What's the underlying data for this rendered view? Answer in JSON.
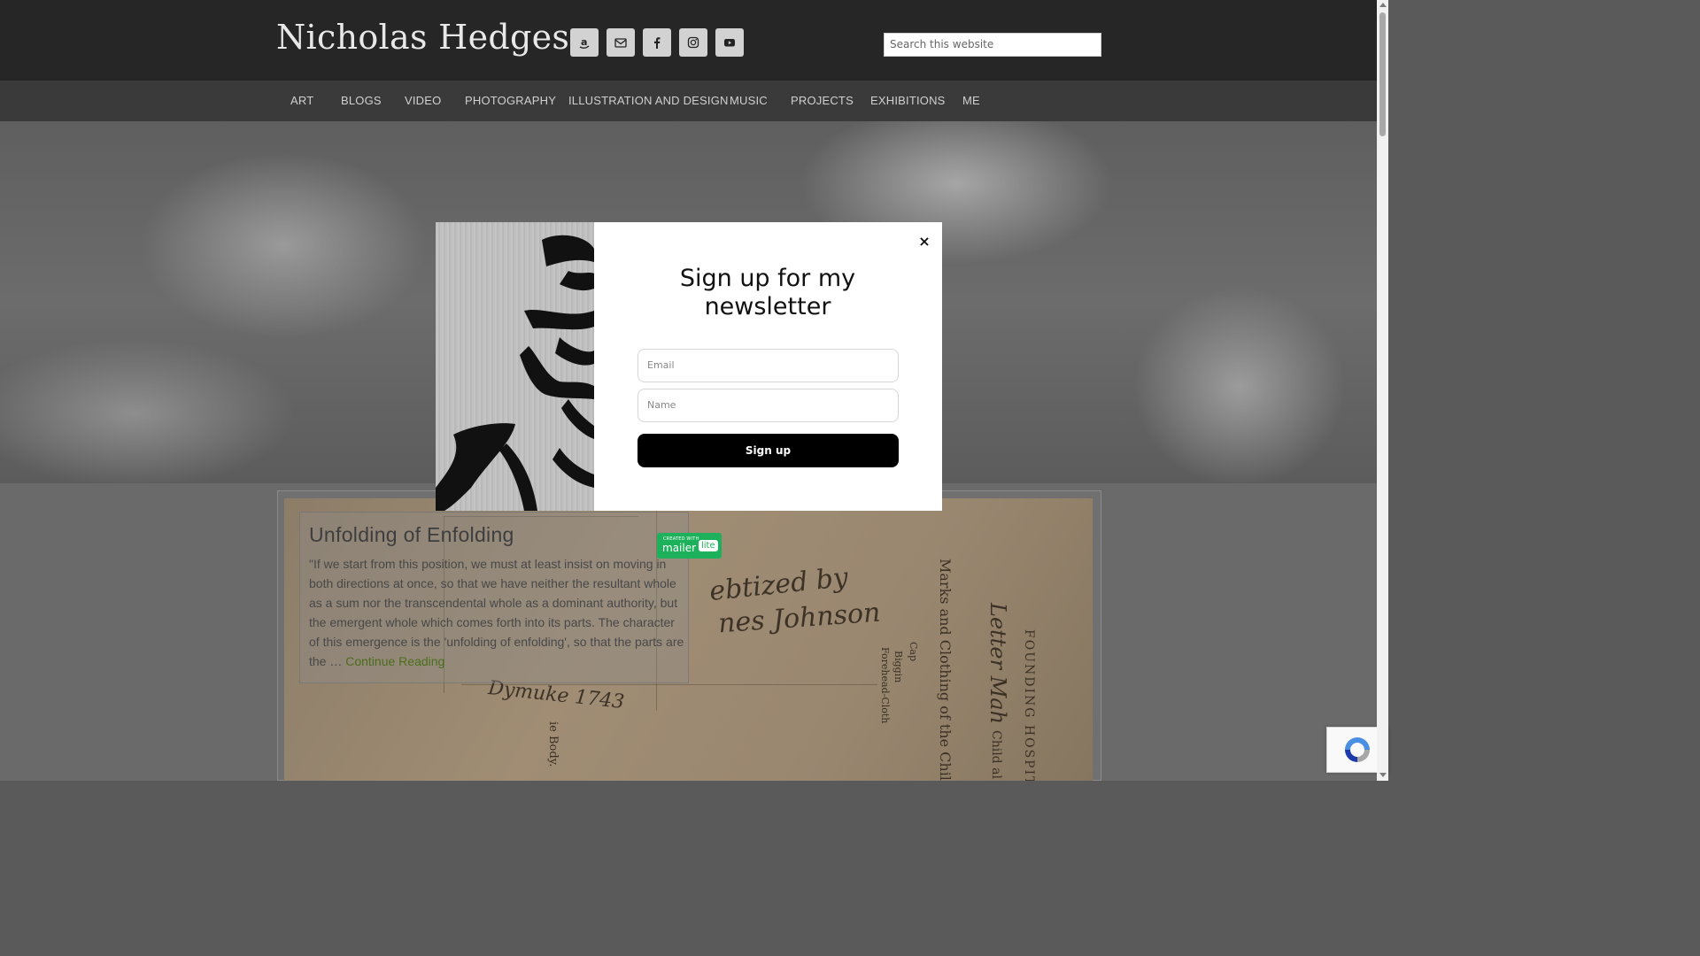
{
  "site": {
    "title": "Nicholas Hedges"
  },
  "social": [
    {
      "name": "amazon-icon",
      "glyph": "a"
    },
    {
      "name": "email-icon",
      "glyph": ""
    },
    {
      "name": "facebook-icon",
      "glyph": "f"
    },
    {
      "name": "instagram-icon",
      "glyph": ""
    },
    {
      "name": "youtube-icon",
      "glyph": ""
    }
  ],
  "search": {
    "placeholder": "Search this website"
  },
  "nav": {
    "items": [
      "ART",
      "BLOGS",
      "VIDEO",
      "PHOTOGRAPHY",
      "ILLUSTRATION AND DESIGN",
      "MUSIC",
      "PROJECTS",
      "EXHIBITIONS",
      "ME"
    ]
  },
  "popup": {
    "close": "×",
    "heading": "Sign up for my newsletter",
    "email_placeholder": "Email",
    "name_placeholder": "Name",
    "button": "Sign up"
  },
  "badge": {
    "small": "CREATED WITH",
    "big": "mailer",
    "lite": "lite"
  },
  "post": {
    "title": "Unfolding of Enfolding",
    "excerpt": "\"If we start from this position, we must at least insist on moving in both directions at once, so that we have neither the resultant whole as a sum nor the transcendental whole as a dominant authority, but the emergent whole which comes forth into its parts. The character of this emergence is the 'unfolding of enfolding', so that the parts are the … ",
    "continue": "Continue Reading"
  },
  "document": {
    "script_lines": [
      "ebtized by",
      "nes Johnson",
      "Dymuke 1743"
    ],
    "vertical_lines": [
      "Marks and Clothing of the Child",
      "Letter Mah",
      "FOUNDING HOSPITAL",
      "Cap",
      "Biggin",
      "Forehead-Cloth",
      "Child al",
      "ie Body."
    ]
  },
  "colors": {
    "header": "#262626",
    "nav": "#3a3a3a",
    "link": "#4a6e1a",
    "badge": "#1cb15a"
  }
}
